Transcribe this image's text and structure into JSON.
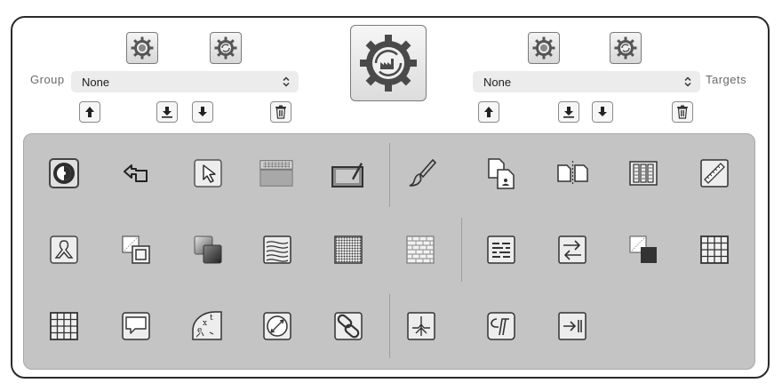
{
  "group": {
    "label": "Group",
    "selected": "None"
  },
  "targets": {
    "label": "Targets",
    "selected": "None"
  },
  "toolbar_icons": [
    "gear-icon",
    "gear-icon",
    "factory-gear-icon",
    "gear-icon",
    "gear-icon",
    "upload-icon",
    "download-icon",
    "download-icon",
    "trash-icon",
    "upload-icon",
    "download-icon",
    "download-icon",
    "trash-icon"
  ],
  "palette": {
    "row1": [
      "circle-target-icon",
      "back-arrow-icon",
      "pointer-icon",
      "keyboard-icon",
      "tablet-pen-icon",
      "brush-icon",
      "document-icon",
      "split-page-icon",
      "columns-icon",
      "ruler-icon"
    ],
    "row2": [
      "ribbon-icon",
      "overlap-squares-icon",
      "layer-gradient-icon",
      "wave-lines-icon",
      "dot-grid-icon",
      "brick-pattern-icon",
      "text-lines-icon",
      "swap-arrows-icon",
      "fill-square-icon",
      "table-grid-icon"
    ],
    "row3": [
      "table-grid-icon",
      "speech-bubble-icon",
      "curved-text-icon",
      "ellipse-diagonal-icon",
      "link-chain-icon",
      "tree-join-icon",
      "paragraph-icon",
      "tab-arrow-icon"
    ]
  },
  "colors": {
    "palette_bg": "#c4c4c4",
    "select_bg": "#ececec",
    "window_border": "#2a2a2a"
  }
}
